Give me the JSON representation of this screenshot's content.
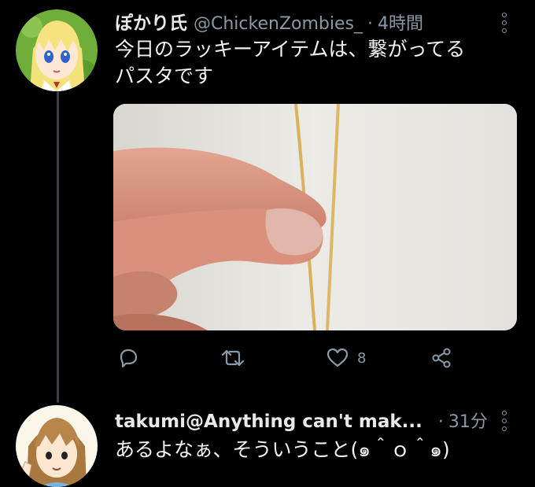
{
  "tweet1": {
    "name": "ぽかり氏",
    "handle": "@ChickenZombies_",
    "separator": "·",
    "time": "4時間",
    "text": "今日のラッキーアイテムは、繋がってる\nパスタです",
    "avatar_icon": "anime-avatar-blonde",
    "media_icon": "photo-hand-holding-spaghetti",
    "actions": {
      "reply_icon": "reply-icon",
      "retweet_icon": "retweet-icon",
      "like_icon": "heart-icon",
      "like_count": "8",
      "share_icon": "share-icon"
    }
  },
  "tweet2": {
    "name": "takumi@Anything can't mak...",
    "separator": "·",
    "time": "31分",
    "text": "あるよなぁ、そういうこと(๑＾ｏ＾๑)",
    "avatar_icon": "anime-avatar-brown-hair"
  },
  "colors": {
    "background": "#000000",
    "primary_text": "#e7e9ea",
    "secondary_text": "#8b98a5",
    "thread_line": "#3c3f44"
  }
}
